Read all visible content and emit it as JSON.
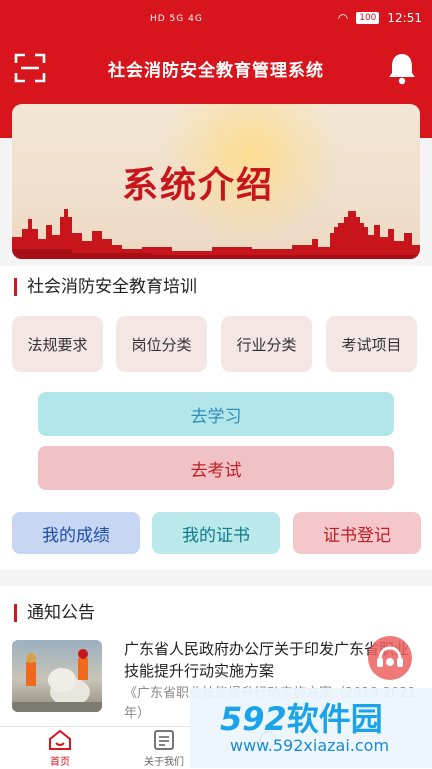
{
  "status_bar": {
    "signal_text": "HD 5G 4G",
    "battery": "100",
    "time": "12:51"
  },
  "header": {
    "title": "社会消防安全教育管理系统",
    "left_icon": "scan-icon",
    "right_icon": "bell-icon"
  },
  "banner": {
    "heading": "系统介绍"
  },
  "training": {
    "title": "社会消防安全教育培训",
    "categories": [
      "法规要求",
      "岗位分类",
      "行业分类",
      "考试项目"
    ],
    "study_label": "去学习",
    "exam_label": "去考试",
    "scores_label": "我的成绩",
    "certs_label": "我的证书",
    "register_label": "证书登记"
  },
  "notices": {
    "title": "通知公告",
    "items": [
      {
        "title": "广东省人民政府办公厅关于印发广东省职业技能提升行动实施方案",
        "desc": "《广东省职业技能提升行动实施方案（2019-2021年）"
      }
    ]
  },
  "bottom_nav": {
    "items": [
      {
        "label": "首页",
        "icon": "home-icon"
      },
      {
        "label": "关于我们",
        "icon": "about-icon"
      },
      {
        "label": "",
        "icon": "center-icon"
      }
    ]
  },
  "watermark": {
    "logo_num": "592",
    "logo_cn": "软件园",
    "url": "www.592xiazai.com"
  },
  "colors": {
    "brand_red": "#d8151c",
    "study_bg": "#b3e6ea",
    "exam_bg": "#f0c2c5",
    "scores_bg": "#c7d6f3",
    "certs_bg": "#b9e9ea",
    "register_bg": "#f4c8cb"
  }
}
